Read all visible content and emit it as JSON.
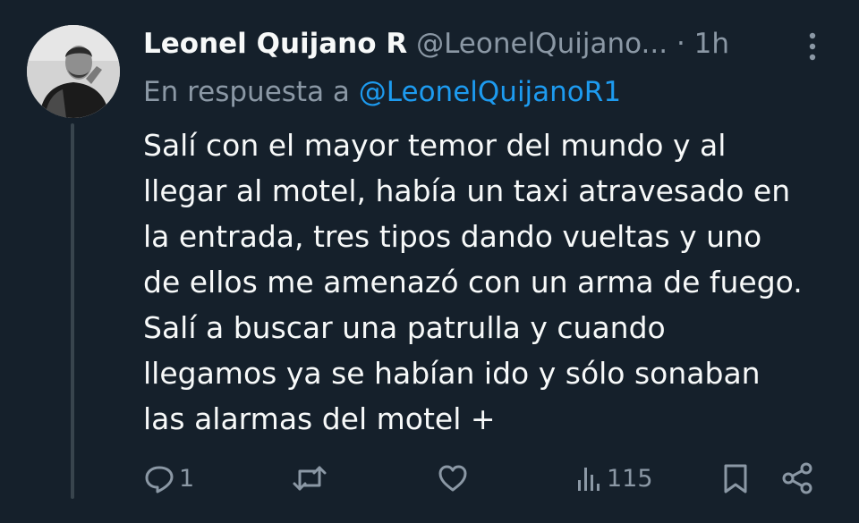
{
  "tweet": {
    "display_name": "Leonel Quijano R",
    "handle": "@LeonelQuijano...",
    "separator": "·",
    "time": "1h",
    "reply_prefix": "En respuesta a",
    "reply_to": "@LeonelQuijanoR1",
    "text_lines": [
      "Salí con el mayor temor del mundo y al",
      "llegar al motel, había un taxi atravesado en",
      "la entrada, tres tipos dando vueltas y uno",
      "de ellos me amenazó con un arma de fuego.",
      "Salí a buscar una patrulla y cuando",
      "llegamos ya se habían ido y sólo sonaban",
      "las alarmas del motel +"
    ]
  },
  "actions": {
    "reply_icon": "reply-icon",
    "reply_count": "1",
    "retweet_icon": "retweet-icon",
    "like_icon": "heart-icon",
    "views_icon": "views-icon",
    "views_count": "115",
    "bookmark_icon": "bookmark-icon",
    "share_icon": "share-icon"
  },
  "colors": {
    "background": "#15202b",
    "primary_text": "#f7f9f9",
    "secondary_text": "#8b98a5",
    "accent": "#1d9bf0",
    "thread_line": "#38444d"
  }
}
